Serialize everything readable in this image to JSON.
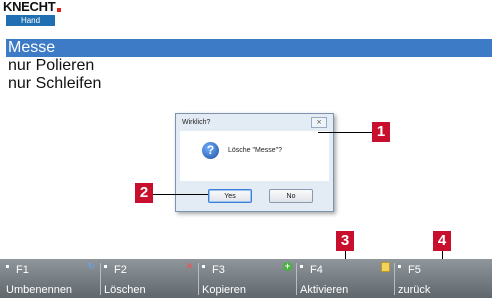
{
  "logo": {
    "brand": "KNECHT",
    "tag": "Hand"
  },
  "list": {
    "items": [
      {
        "label": "Messe",
        "selected": true
      },
      {
        "label": "nur Polieren",
        "selected": false
      },
      {
        "label": "nur Schleifen",
        "selected": false
      }
    ]
  },
  "dialog": {
    "title": "Wirklich?",
    "close_label": "⨯",
    "message": "Lösche \"Messe\"?",
    "yes_label": "Yes",
    "no_label": "No"
  },
  "callouts": [
    "1",
    "2",
    "3",
    "4"
  ],
  "fkeys": [
    {
      "key": "F1",
      "label": "Umbenennen",
      "icon": "rename-icon"
    },
    {
      "key": "F2",
      "label": "Löschen",
      "icon": "delete-icon"
    },
    {
      "key": "F3",
      "label": "Kopieren",
      "icon": "copy-icon"
    },
    {
      "key": "F4",
      "label": "Aktivieren",
      "icon": "activate-icon"
    },
    {
      "key": "F5",
      "label": "zurück",
      "icon": ""
    }
  ],
  "colors": {
    "selection": "#3d7bc6",
    "callout": "#c8102e",
    "fkeybar": "#6f767c"
  }
}
